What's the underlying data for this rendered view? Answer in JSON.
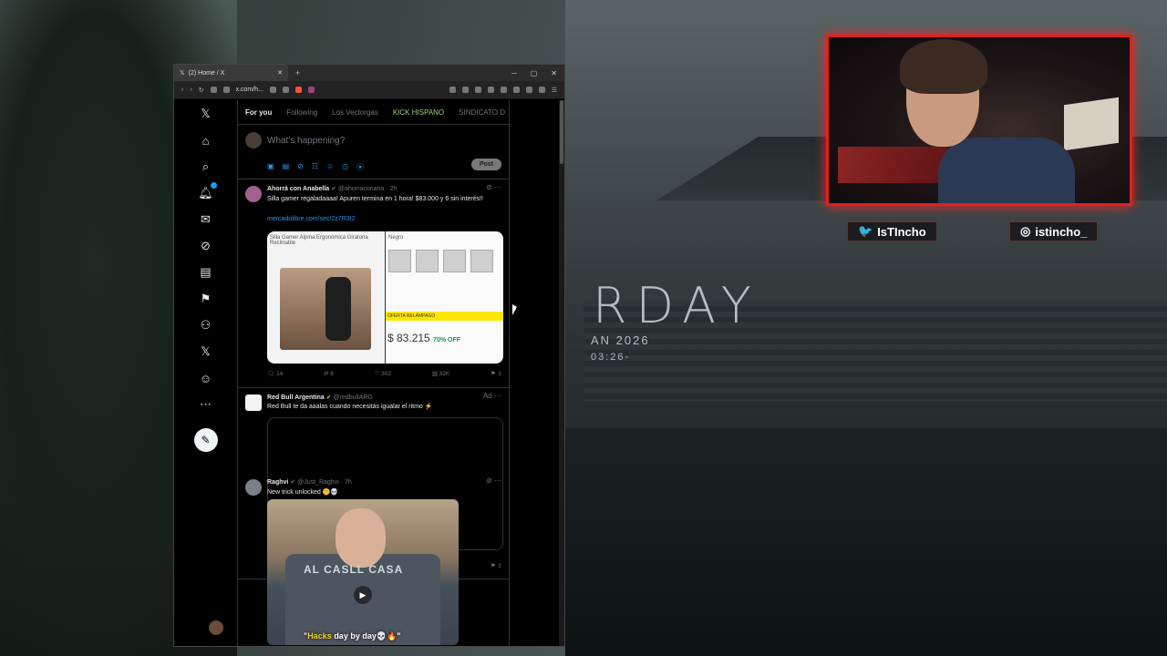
{
  "background": {
    "title_fragment": "RDAY",
    "date_fragment": "AN 2026",
    "time_fragment": "03:26-"
  },
  "stream": {
    "twitter_handle": "IsTIncho",
    "instagram_handle": "istincho_",
    "accent_color": "#e02020"
  },
  "browser": {
    "tab_title": "(2) Home / X",
    "url": "x.com/h..."
  },
  "x": {
    "feed_tabs": [
      "For you",
      "Following",
      "Los Vectorgas",
      "KICK HISPANO",
      "SINDICATO D"
    ],
    "composer_placeholder": "What's happening?",
    "post_label": "Post",
    "tweets": [
      {
        "name": "Ahorrá con Anabella",
        "handle": "@ahorraconana",
        "time": "· 2h",
        "text": "Silla gamer regaladaaaa! Apuren termina en 1 hora! $83.000 y 6 sin interés!!",
        "link": "mercadolibre.com/sec/2z7R3t2",
        "media_left_label": "Silla Gamer Alpina Ergonómica Giratoria Reclinable",
        "media_right_label": "Negro",
        "media_bar": "OFERTA RELÁMPAGO",
        "price": "$ 83.215",
        "discount": "70% OFF",
        "replies": "14",
        "reposts": "8",
        "likes": "302",
        "views": "32K"
      },
      {
        "name": "Red Bull Argentina",
        "handle": "@redbullARG",
        "ad_label": "Ad",
        "text": "Red Bull te da aaalas cuando necesitás igualar el ritmo ⚡"
      },
      {
        "name": "Raghvi",
        "handle": "@Just_Raghvi",
        "time": "· 7h",
        "text": "New trick unlocked 🤫💀",
        "shirt_text": "AL CASLL CASA",
        "caption_highlight": "Hacks",
        "caption_rest": " day by day💀🔥"
      }
    ]
  }
}
